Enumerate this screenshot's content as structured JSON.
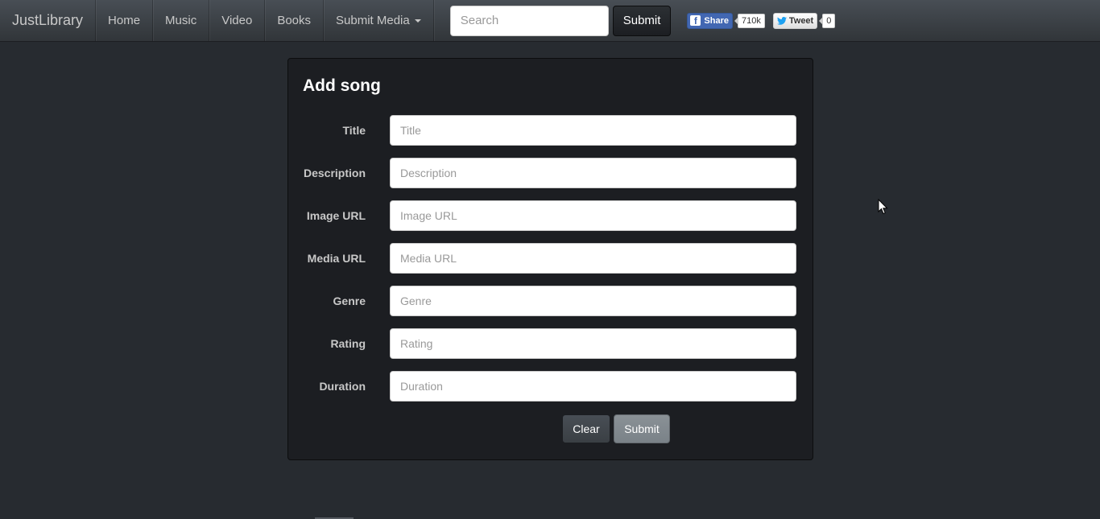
{
  "navbar": {
    "brand": "JustLibrary",
    "links": [
      {
        "label": "Home"
      },
      {
        "label": "Music"
      },
      {
        "label": "Video"
      },
      {
        "label": "Books"
      },
      {
        "label": "Submit Media"
      }
    ],
    "search": {
      "placeholder": "Search",
      "value": ""
    },
    "submit_label": "Submit",
    "social": {
      "facebook": {
        "label": "Share",
        "count": "710k",
        "icon": "f"
      },
      "twitter": {
        "label": "Tweet",
        "count": "0"
      }
    }
  },
  "panel": {
    "title": "Add song",
    "fields": [
      {
        "label": "Title",
        "placeholder": "Title"
      },
      {
        "label": "Description",
        "placeholder": "Description"
      },
      {
        "label": "Image URL",
        "placeholder": "Image URL"
      },
      {
        "label": "Media URL",
        "placeholder": "Media URL"
      },
      {
        "label": "Genre",
        "placeholder": "Genre"
      },
      {
        "label": "Rating",
        "placeholder": "Rating"
      },
      {
        "label": "Duration",
        "placeholder": "Duration"
      }
    ],
    "clear_label": "Clear",
    "submit_label": "Submit"
  },
  "colors": {
    "background": "#272b30",
    "panel": "#1c1e22",
    "facebook": "#4267b2",
    "twitter": "#1da1f2"
  },
  "icons": [
    "facebook-icon",
    "twitter-icon",
    "caret-down-icon",
    "mouse-cursor-icon"
  ]
}
